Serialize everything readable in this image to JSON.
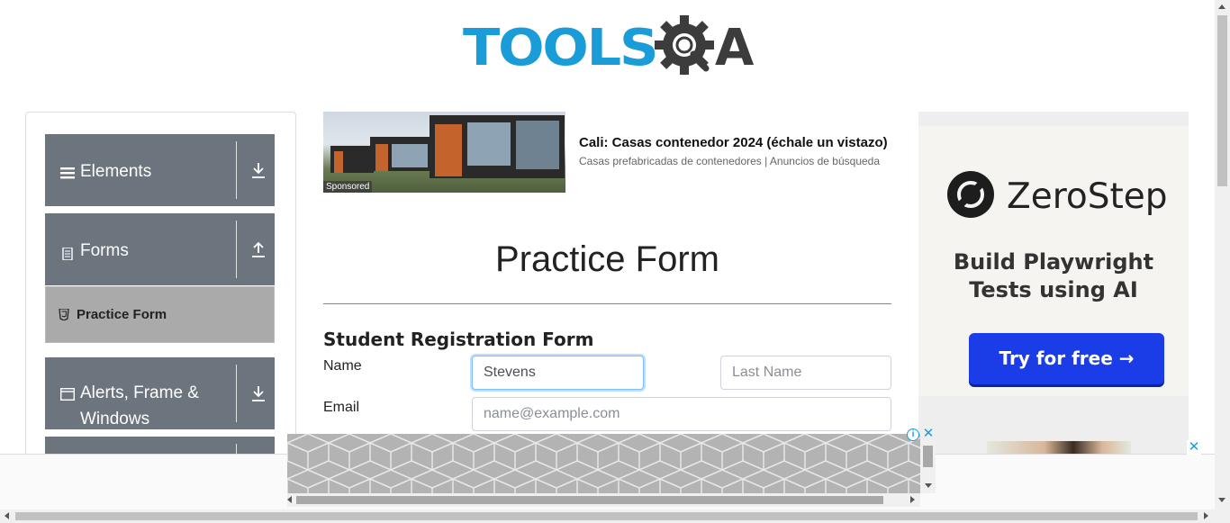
{
  "brand": {
    "logo_text": "TOOLS",
    "logo_suffix": "A",
    "primary_color": "#1a9cd8",
    "dark_color": "#3c3c3c"
  },
  "sidebar": {
    "groups": [
      {
        "label": "Elements",
        "icon": "hamburger-icon",
        "toggle": "download-arrow-icon"
      },
      {
        "label": "Forms",
        "icon": "document-icon",
        "toggle": "upload-arrow-icon"
      },
      {
        "label": "Alerts, Frame &",
        "label2": "Windows",
        "icon": "window-icon",
        "toggle": "download-arrow-icon"
      }
    ],
    "active_item": {
      "label": "Practice Form",
      "icon": "html5-icon"
    }
  },
  "top_ad": {
    "badge": "Sponsored",
    "title": "Cali: Casas contenedor 2024 (échale un vistazo)",
    "subtitle": "Casas prefabricadas de contenedores | Anuncios de búsqueda"
  },
  "main": {
    "page_title": "Practice Form",
    "form_heading": "Student Registration Form",
    "name_label": "Name",
    "first_name_value": "Stevens",
    "last_name_placeholder": "Last Name",
    "email_label": "Email",
    "email_placeholder": "name@example.com"
  },
  "right_ad": {
    "brand": "ZeroStep",
    "tagline_line1": "Build Playwright",
    "tagline_line2": "Tests using AI",
    "cta": "Try for free →"
  },
  "bottom_ad": {
    "info": "i",
    "close": "✕"
  }
}
